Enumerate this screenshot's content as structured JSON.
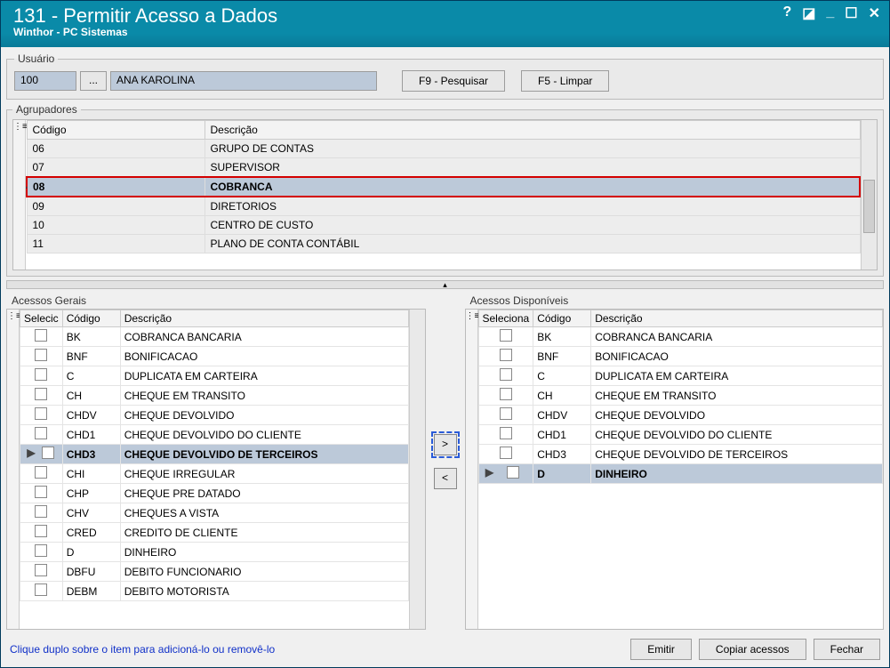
{
  "title": "131 - Permitir Acesso a Dados",
  "subtitle": "Winthor - PC Sistemas",
  "usuario": {
    "legend": "Usuário",
    "code": "100",
    "lookup": "...",
    "name": "ANA KAROLINA",
    "btn_search": "F9 - Pesquisar",
    "btn_clear": "F5 - Limpar"
  },
  "agrupadores": {
    "legend": "Agrupadores",
    "col_codigo": "Código",
    "col_descricao": "Descrição",
    "rows": [
      {
        "codigo": "06",
        "descricao": "GRUPO DE CONTAS"
      },
      {
        "codigo": "07",
        "descricao": "SUPERVISOR"
      },
      {
        "codigo": "08",
        "descricao": "COBRANCA"
      },
      {
        "codigo": "09",
        "descricao": "DIRETORIOS"
      },
      {
        "codigo": "10",
        "descricao": "CENTRO DE CUSTO"
      },
      {
        "codigo": "11",
        "descricao": "PLANO DE CONTA CONTÁBIL"
      }
    ],
    "selected_index": 2
  },
  "acessos_gerais": {
    "title": "Acessos Gerais",
    "col_select": "Selecic",
    "col_codigo": "Código",
    "col_descricao": "Descrição",
    "rows": [
      {
        "codigo": "BK",
        "descricao": "COBRANCA BANCARIA"
      },
      {
        "codigo": "BNF",
        "descricao": "BONIFICACAO"
      },
      {
        "codigo": "C",
        "descricao": "DUPLICATA EM CARTEIRA"
      },
      {
        "codigo": "CH",
        "descricao": "CHEQUE EM TRANSITO"
      },
      {
        "codigo": "CHDV",
        "descricao": "CHEQUE DEVOLVIDO"
      },
      {
        "codigo": "CHD1",
        "descricao": "CHEQUE DEVOLVIDO DO CLIENTE"
      },
      {
        "codigo": "CHD3",
        "descricao": "CHEQUE DEVOLVIDO DE TERCEIROS"
      },
      {
        "codigo": "CHI",
        "descricao": "CHEQUE IRREGULAR"
      },
      {
        "codigo": "CHP",
        "descricao": "CHEQUE PRE DATADO"
      },
      {
        "codigo": "CHV",
        "descricao": "CHEQUES A VISTA"
      },
      {
        "codigo": "CRED",
        "descricao": "CREDITO DE CLIENTE"
      },
      {
        "codigo": "D",
        "descricao": "DINHEIRO"
      },
      {
        "codigo": "DBFU",
        "descricao": "DEBITO FUNCIONARIO"
      },
      {
        "codigo": "DEBM",
        "descricao": "DEBITO MOTORISTA"
      }
    ],
    "selected_index": 6
  },
  "acessos_disponiveis": {
    "title": "Acessos Disponíveis",
    "col_select": "Seleciona",
    "col_codigo": "Código",
    "col_descricao": "Descrição",
    "rows": [
      {
        "codigo": "BK",
        "descricao": "COBRANCA BANCARIA"
      },
      {
        "codigo": "BNF",
        "descricao": "BONIFICACAO"
      },
      {
        "codigo": "C",
        "descricao": "DUPLICATA EM CARTEIRA"
      },
      {
        "codigo": "CH",
        "descricao": "CHEQUE EM TRANSITO"
      },
      {
        "codigo": "CHDV",
        "descricao": "CHEQUE DEVOLVIDO"
      },
      {
        "codigo": "CHD1",
        "descricao": "CHEQUE DEVOLVIDO DO CLIENTE"
      },
      {
        "codigo": "CHD3",
        "descricao": "CHEQUE DEVOLVIDO DE TERCEIROS"
      },
      {
        "codigo": "D",
        "descricao": "DINHEIRO"
      }
    ],
    "selected_index": 7
  },
  "transfer": {
    "to_right": ">",
    "to_left": "<"
  },
  "footer": {
    "hint": "Clique duplo sobre o item para adicioná-lo ou removê-lo",
    "btn_emitir": "Emitir",
    "btn_copiar": "Copiar acessos",
    "btn_fechar": "Fechar"
  }
}
